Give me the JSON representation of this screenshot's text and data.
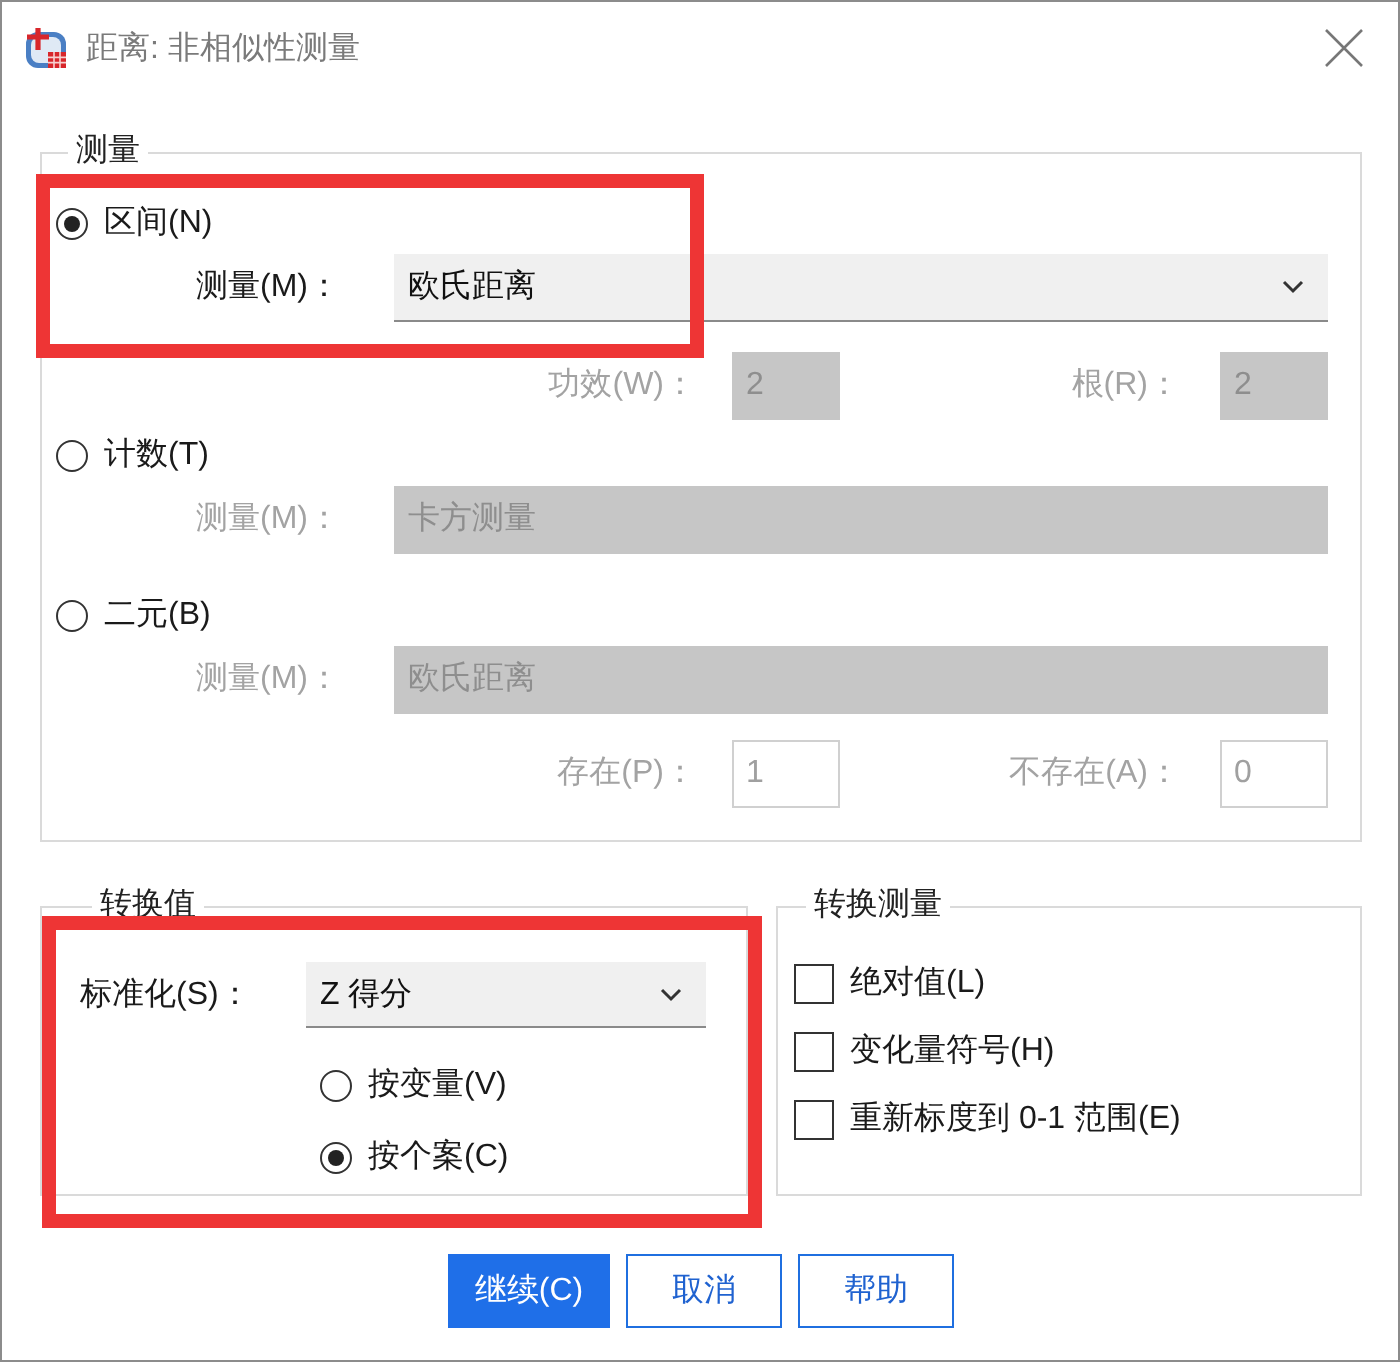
{
  "window": {
    "title": "距离: 非相似性测量"
  },
  "measure_group": {
    "legend": "测量",
    "options": [
      {
        "label": "区间(N)",
        "selected": true,
        "highlighted": true,
        "measure": {
          "label": "测量(M)：",
          "value": "欧氏距离",
          "disabled": false
        },
        "params": [
          {
            "label": "功效(W)：",
            "value": "2",
            "disabled": true,
            "shaded": true
          },
          {
            "label": "根(R)：",
            "value": "2",
            "disabled": true,
            "shaded": true
          }
        ]
      },
      {
        "label": "计数(T)",
        "selected": false,
        "highlighted": false,
        "measure": {
          "label": "测量(M)：",
          "value": "卡方测量",
          "disabled": true
        }
      },
      {
        "label": "二元(B)",
        "selected": false,
        "highlighted": false,
        "measure": {
          "label": "测量(M)：",
          "value": "欧氏距离",
          "disabled": true
        },
        "params": [
          {
            "label": "存在(P)：",
            "value": "1",
            "disabled": true,
            "shaded": false
          },
          {
            "label": "不存在(A)：",
            "value": "0",
            "disabled": true,
            "shaded": false
          }
        ]
      }
    ]
  },
  "transform_values": {
    "legend": "转换值",
    "highlighted": true,
    "standardize": {
      "label": "标准化(S)：",
      "value": "Z 得分"
    },
    "options": [
      {
        "label": "按变量(V)",
        "selected": false
      },
      {
        "label": "按个案(C)",
        "selected": true
      }
    ]
  },
  "transform_measures": {
    "legend": "转换测量",
    "options": [
      {
        "label": "绝对值(L)",
        "checked": false
      },
      {
        "label": "变化量符号(H)",
        "checked": false
      },
      {
        "label": "重新标度到 0-1 范围(E)",
        "checked": false
      }
    ]
  },
  "buttons": [
    {
      "label": "继续(C)",
      "primary": true
    },
    {
      "label": "取消",
      "primary": false
    },
    {
      "label": "帮助",
      "primary": false
    }
  ]
}
